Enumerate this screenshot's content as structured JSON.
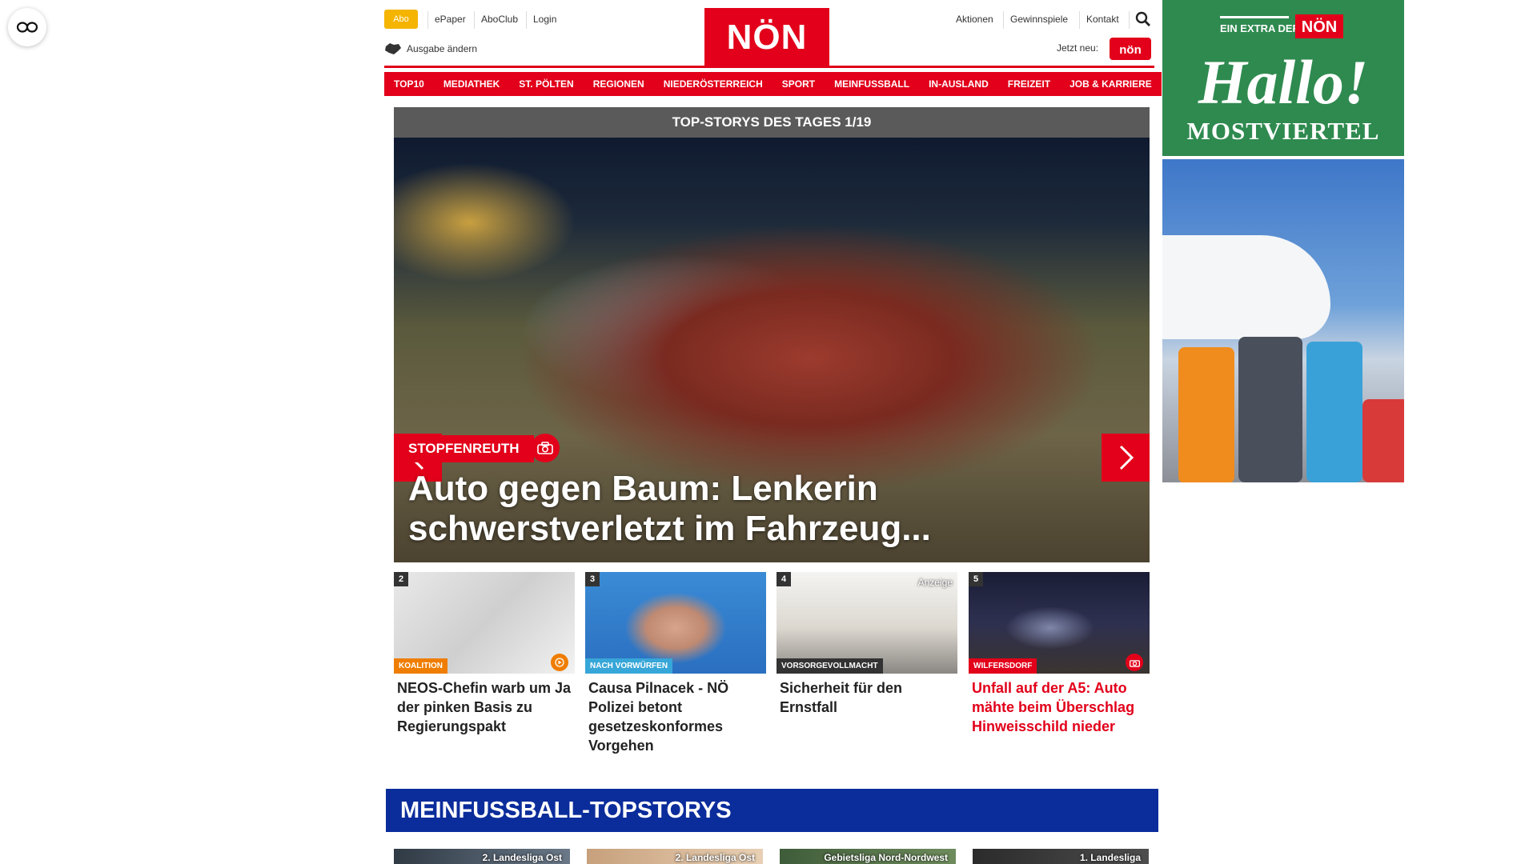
{
  "floating_button": {
    "icon": "eye-icon"
  },
  "header": {
    "abo_label": "Abo",
    "links": [
      "ePaper",
      "AboClub",
      "Login"
    ],
    "right_links": [
      "Aktionen",
      "Gewinnspiele",
      "Kontakt"
    ],
    "logo_text": "NÖN",
    "edition_label": "Ausgabe ändern",
    "jetzt_label": "Jetzt neu:",
    "jetzt_logo_text": "nön",
    "brand_color": "#e2001a"
  },
  "nav": [
    "TOP10",
    "MEDIATHEK",
    "ST. PÖLTEN",
    "REGIONEN",
    "NIEDERÖSTERREICH",
    "SPORT",
    "MEINFUSSBALL",
    "IN-AUSLAND",
    "FREIZEIT",
    "JOB & KARRIERE"
  ],
  "hero": {
    "bar_title": "TOP-STORYS DES TAGES 1/19",
    "tag": "STOPFENREUTH",
    "title": "Auto gegen Baum: Lenkerin schwerstverletzt im Fahrzeug...",
    "icon": "camera-icon"
  },
  "teasers": [
    {
      "num": "2",
      "tag": "KOALITION",
      "tag_color": "#ef7d00",
      "title": "NEOS-Chefin warb um Ja der pinken Basis zu Regierungspakt",
      "badge": "play-icon"
    },
    {
      "num": "3",
      "tag": "NACH VORWÜRFEN",
      "tag_color": "#37a6d8",
      "title": "Causa Pilnacek - NÖ Polizei betont gesetzeskonformes Vorgehen"
    },
    {
      "num": "4",
      "tag": "VORSORGEVOLLMACHT",
      "tag_color": "#333333",
      "title": "Sicherheit für den Ernstfall",
      "anzeige": "Anzeige"
    },
    {
      "num": "5",
      "tag": "WILFERSDORF",
      "tag_color": "#e2001a",
      "title": "Unfall auf der A5: Auto mähte beim Überschlag Hinweisschild nieder",
      "badge": "camera-icon",
      "title_color": "#e2001a"
    }
  ],
  "section": {
    "title": "MEINFUSSBALL-TOPSTORYS"
  },
  "football": [
    "2. Landesliga Ost",
    "2. Landesliga Ost",
    "Gebietsliga Nord-Nordwest",
    "1. Landesliga"
  ],
  "ad": {
    "top_line": "EIN EXTRA DER",
    "logo": "NÖN",
    "headline": "Hallo!",
    "subline": "MOSTVIERTEL"
  }
}
